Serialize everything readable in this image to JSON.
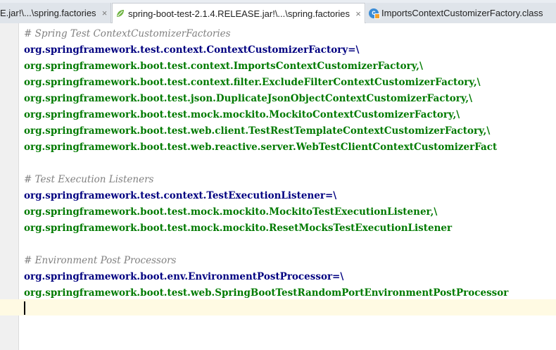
{
  "tabs": [
    {
      "label": "E.jar!\\...\\spring.factories",
      "close": "×"
    },
    {
      "label": "spring-boot-test-2.1.4.RELEASE.jar!\\...\\spring.factories",
      "close": "×"
    },
    {
      "label": "ImportsContextCustomizerFactory.class",
      "close": "×"
    }
  ],
  "editor": {
    "lines": [
      {
        "type": "comment",
        "text": "# Spring Test ContextCustomizerFactories"
      },
      {
        "type": "key",
        "text": "org.springframework.test.context.ContextCustomizerFactory=\\"
      },
      {
        "type": "val",
        "text": "org.springframework.boot.test.context.ImportsContextCustomizerFactory,\\"
      },
      {
        "type": "val",
        "text": "org.springframework.boot.test.context.filter.ExcludeFilterContextCustomizerFactory,\\"
      },
      {
        "type": "val",
        "text": "org.springframework.boot.test.json.DuplicateJsonObjectContextCustomizerFactory,\\"
      },
      {
        "type": "val",
        "text": "org.springframework.boot.test.mock.mockito.MockitoContextCustomizerFactory,\\"
      },
      {
        "type": "val",
        "text": "org.springframework.boot.test.web.client.TestRestTemplateContextCustomizerFactory,\\"
      },
      {
        "type": "val",
        "text": "org.springframework.boot.test.web.reactive.server.WebTestClientContextCustomizerFact"
      },
      {
        "type": "blank",
        "text": ""
      },
      {
        "type": "comment",
        "text": "# Test Execution Listeners"
      },
      {
        "type": "key",
        "text": "org.springframework.test.context.TestExecutionListener=\\"
      },
      {
        "type": "val",
        "text": "org.springframework.boot.test.mock.mockito.MockitoTestExecutionListener,\\"
      },
      {
        "type": "val",
        "text": "org.springframework.boot.test.mock.mockito.ResetMocksTestExecutionListener"
      },
      {
        "type": "blank",
        "text": ""
      },
      {
        "type": "comment",
        "text": "# Environment Post Processors"
      },
      {
        "type": "key",
        "text": "org.springframework.boot.env.EnvironmentPostProcessor=\\"
      },
      {
        "type": "val",
        "text": "org.springframework.boot.test.web.SpringBootTestRandomPortEnvironmentPostProcessor"
      },
      {
        "type": "blank",
        "text": ""
      }
    ]
  },
  "colors": {
    "comment": "#808080",
    "key": "#000080",
    "value": "#007a00",
    "caret_line": "#fffae3"
  },
  "icons": {
    "tab2": "spring-leaf-icon",
    "tab3": "class-file-icon"
  }
}
